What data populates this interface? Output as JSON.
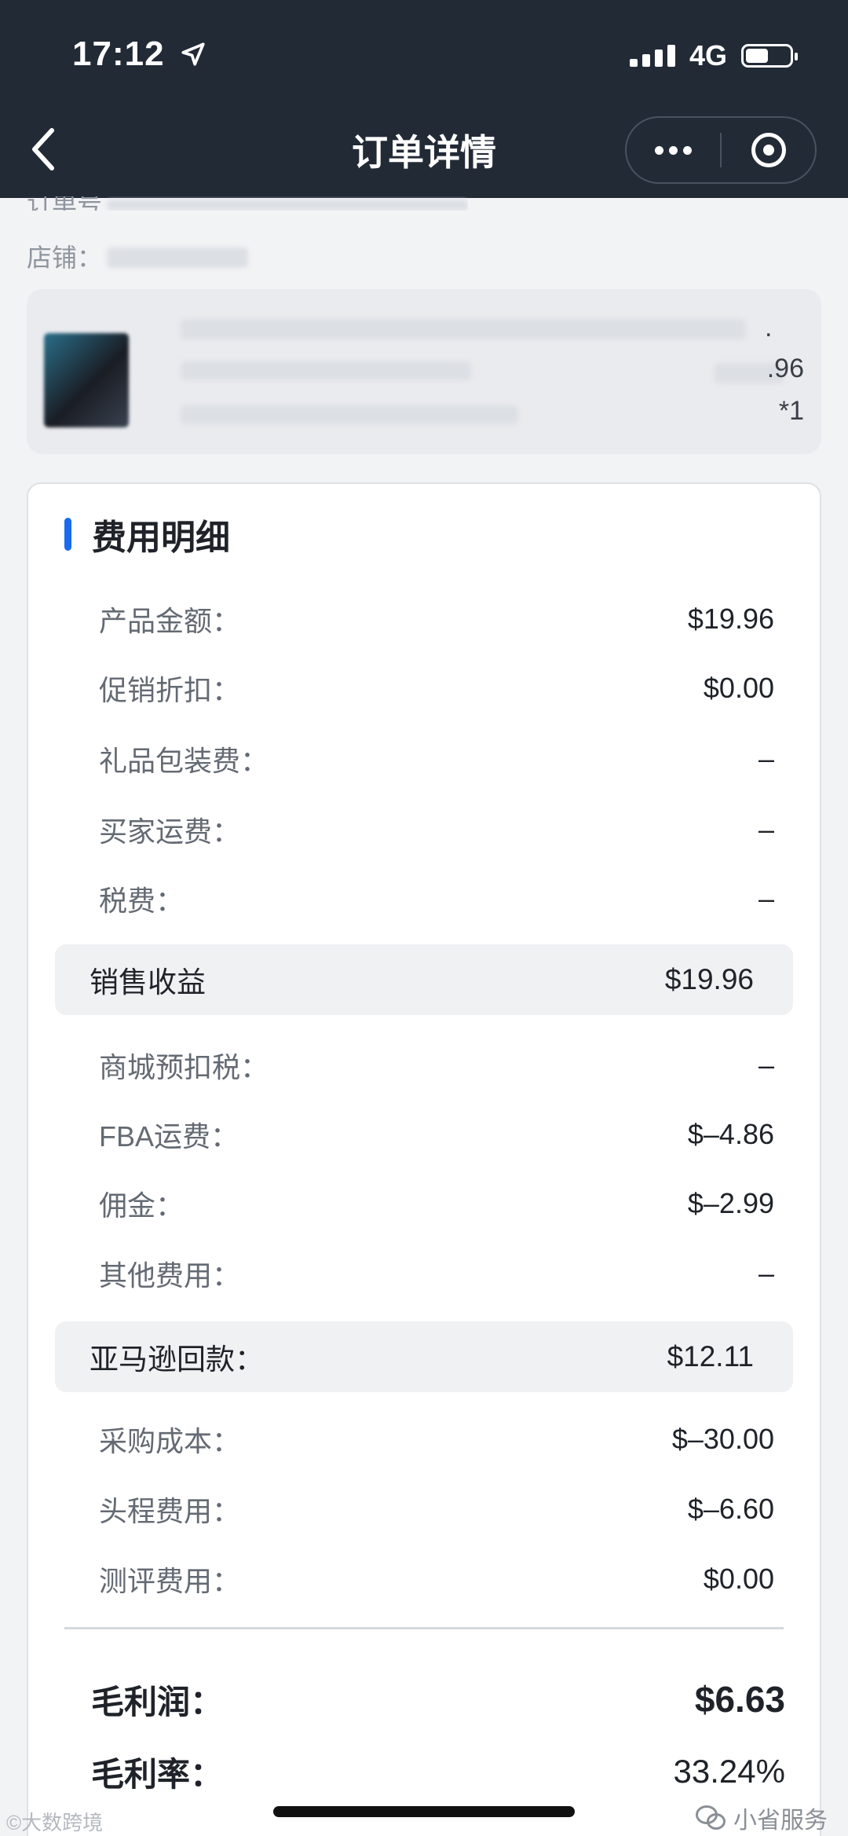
{
  "status_bar": {
    "time": "17:12",
    "network": "4G"
  },
  "nav": {
    "title": "订单详情"
  },
  "order": {
    "order_no_label": "订单号",
    "shop_label": "店铺："
  },
  "product": {
    "price_suffix": ".96",
    "quantity": "*1",
    "dot": "."
  },
  "fees": {
    "title": "费用明细",
    "items_1": [
      {
        "label": "产品金额：",
        "value": "$19.96"
      },
      {
        "label": "促销折扣：",
        "value": "$0.00"
      },
      {
        "label": "礼品包装费：",
        "value": "–"
      },
      {
        "label": "买家运费：",
        "value": "–"
      },
      {
        "label": "税费：",
        "value": "–"
      }
    ],
    "sales_income": {
      "label": "销售收益",
      "value": "$19.96"
    },
    "items_2": [
      {
        "label": "商城预扣税：",
        "value": "–"
      },
      {
        "label": "FBA运费：",
        "value": "$–4.86"
      },
      {
        "label": "佣金：",
        "value": "$–2.99"
      },
      {
        "label": "其他费用：",
        "value": "–"
      }
    ],
    "amazon_payout": {
      "label": "亚马逊回款：",
      "value": "$12.11"
    },
    "items_3": [
      {
        "label": "采购成本：",
        "value": "$–30.00"
      },
      {
        "label": "头程费用：",
        "value": "$–6.60"
      },
      {
        "label": "测评费用：",
        "value": "$0.00"
      }
    ],
    "gross_profit": {
      "label": "毛利润：",
      "value": "$6.63"
    },
    "gross_margin": {
      "label": "毛利率：",
      "value": "33.24%"
    }
  },
  "watermarks": {
    "left": "©大数跨境",
    "right": "小省服务"
  },
  "colors": {
    "header_bg": "#222a36",
    "accent": "#1a6bef"
  },
  "icons": [
    "location-arrow-icon",
    "signal-icon",
    "battery-icon",
    "back-chevron-icon",
    "more-dots-icon",
    "close-target-icon",
    "wechat-icon"
  ]
}
